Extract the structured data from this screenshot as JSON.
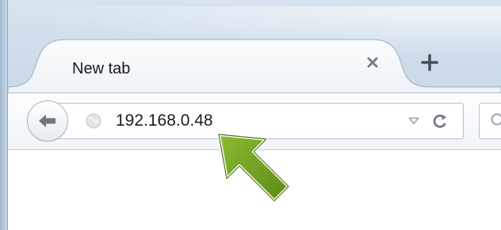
{
  "browser": {
    "tab": {
      "title": "New tab",
      "close_icon": "close-icon"
    },
    "new_tab_icon": "plus-icon",
    "toolbar": {
      "back_icon": "back-arrow-icon",
      "address": {
        "value": "192.168.0.48",
        "site_icon": "globe-icon",
        "dropmarker_icon": "dropdown-triangle-icon",
        "reload_icon": "reload-icon"
      },
      "search_icon": "search-icon"
    }
  },
  "annotation": {
    "arrow_icon": "pointer-arrow-icon",
    "arrow_color": "#6a9a1f"
  }
}
